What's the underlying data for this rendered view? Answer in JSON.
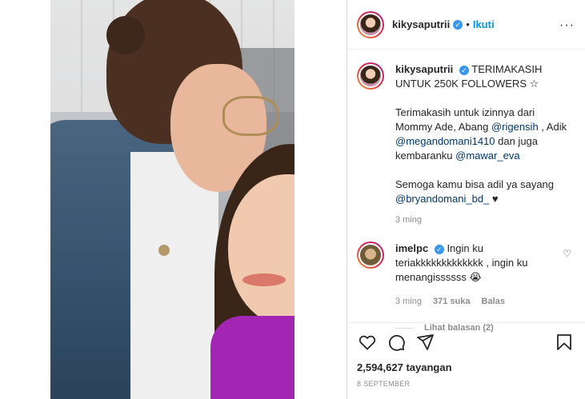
{
  "header": {
    "username": "kikysaputrii",
    "separator": "•",
    "follow_label": "Ikuti",
    "more_label": "···"
  },
  "caption": {
    "username": "kikysaputrii",
    "headline": "TERIMAKASIH UNTUK 250K FOLLOWERS ☆",
    "p1_a": "Terimakasih untuk izinnya dari Mommy Ade, Abang ",
    "m1": "@rigensih",
    "p1_b": " , Adik ",
    "m2": "@megandomani1410",
    "p1_c": " dan juga kembaranku ",
    "m3": "@mawar_eva",
    "p2_a": "Semoga kamu bisa adil ya sayang ",
    "m4": "@bryandomani_bd_",
    "p2_b": " ♥",
    "time": "3 ming"
  },
  "comment": {
    "username": "imelpc",
    "text": "Ingin ku teriakkkkkkkkkkkkk , ingin ku menangissssss 😭",
    "time": "3 ming",
    "likes": "371 suka",
    "reply_label": "Balas",
    "view_replies": "Lihat balasan (2)"
  },
  "actions": {
    "views": "2,594,627 tayangan",
    "date": "8 SEPTEMBER"
  },
  "colors": {
    "accent": "#0095f6",
    "mention": "#00376b",
    "muted": "#8e8e8e"
  }
}
